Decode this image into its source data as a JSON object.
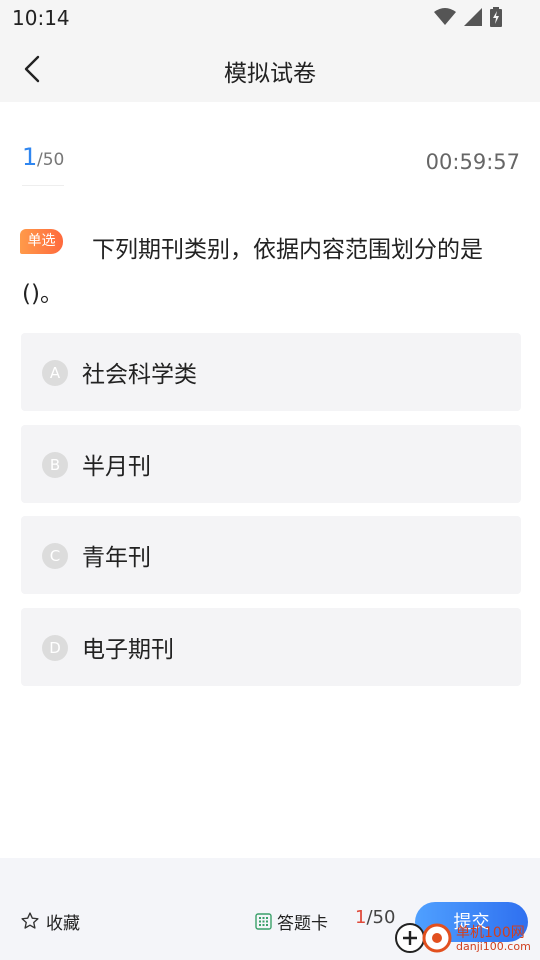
{
  "status_bar": {
    "time": "10:14"
  },
  "header": {
    "title": "模拟试卷"
  },
  "progress": {
    "current": "1",
    "total": "/50"
  },
  "timer": "00:59:57",
  "question": {
    "type_badge": "单选",
    "text": "下列期刊类别，依据内容范围划分的是()。"
  },
  "options": [
    {
      "letter": "A",
      "text": "社会科学类"
    },
    {
      "letter": "B",
      "text": "半月刊"
    },
    {
      "letter": "C",
      "text": "青年刊"
    },
    {
      "letter": "D",
      "text": "电子期刊"
    }
  ],
  "footer": {
    "favorite_label": "收藏",
    "answer_card_label": "答题卡",
    "progress_current": "1",
    "progress_total": "/50",
    "submit_label": "提交"
  },
  "watermark": {
    "text": "单机100网",
    "url": "danji100.com"
  },
  "colors": {
    "accent": "#2f86f0",
    "badge": "#ff7a40",
    "submit": "#3f86f5"
  }
}
